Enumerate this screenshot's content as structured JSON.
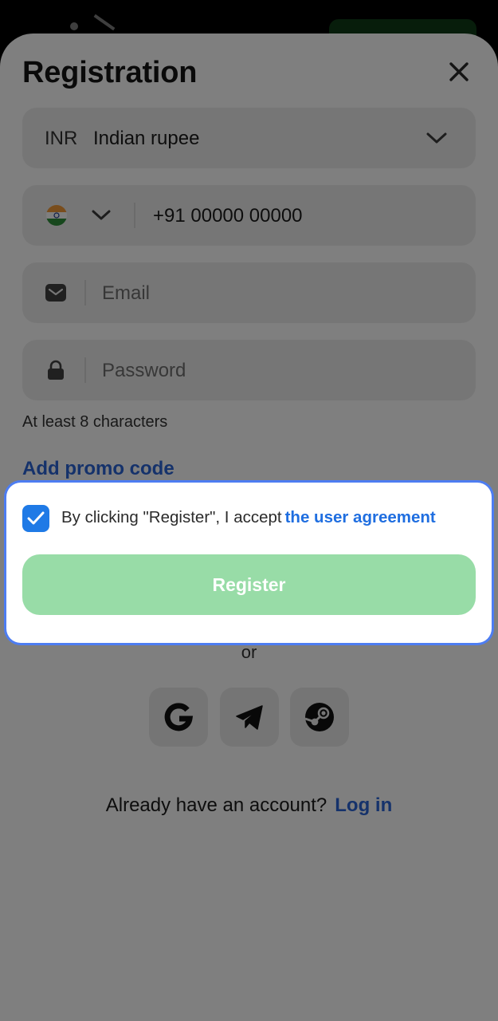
{
  "form": {
    "title": "Registration",
    "currency": {
      "code": "INR",
      "name": "Indian rupee"
    },
    "phone": {
      "value": "+91 00000 00000",
      "country": "India"
    },
    "email": {
      "placeholder": "Email"
    },
    "password": {
      "placeholder": "Password",
      "hint": "At least 8 characters"
    },
    "promo_label": "Add promo code",
    "agreement": {
      "checked": true,
      "text": "By clicking \"Register\", I accept",
      "link": "the user agreement"
    },
    "register_label": "Register",
    "or_label": "or",
    "social": [
      "google-icon",
      "telegram-icon",
      "steam-icon"
    ],
    "login_prompt": "Already have an account?",
    "login_link": "Log in"
  },
  "colors": {
    "accent": "#2a64d6",
    "register_disabled": "#98dca7",
    "checkbox": "#1f7ae6",
    "highlight_border": "#4d7df2"
  }
}
